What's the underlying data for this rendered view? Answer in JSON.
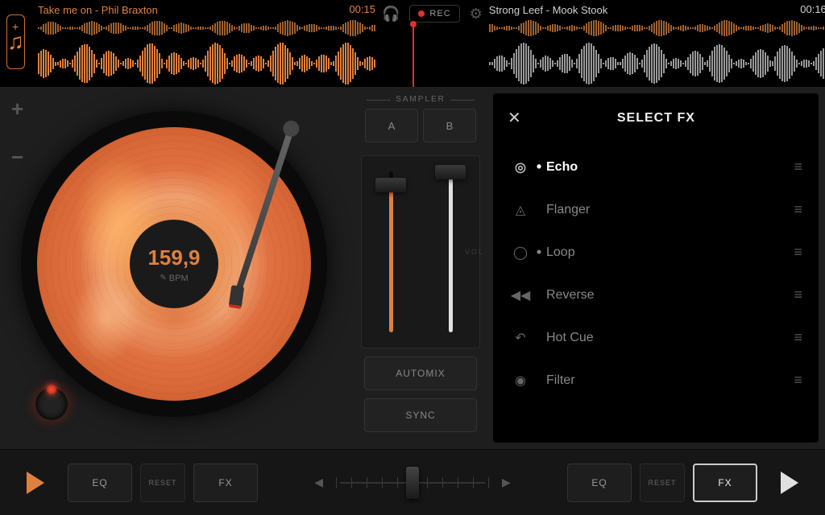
{
  "tracks": {
    "left": {
      "title": "Take me on - Phil Braxton",
      "time": "00:15"
    },
    "right": {
      "title": "Strong Leef - Mook Stook",
      "time": "00:16"
    }
  },
  "rec": {
    "label": "REC"
  },
  "deck": {
    "bpm_value": "159,9",
    "bpm_label": "BPM"
  },
  "sampler": {
    "title": "SAMPLER",
    "a": "A",
    "b": "B",
    "vol": "VOL"
  },
  "mixer": {
    "automix": "AUTOMIX",
    "sync": "SYNC"
  },
  "fx_panel": {
    "title": "SELECT FX",
    "items": [
      {
        "name": "Echo",
        "icon": "◎",
        "bullet": "•",
        "selected": true
      },
      {
        "name": "Flanger",
        "icon": "◬",
        "bullet": "",
        "selected": false
      },
      {
        "name": "Loop",
        "icon": "◯",
        "bullet": "•",
        "selected": false
      },
      {
        "name": "Reverse",
        "icon": "◀◀",
        "bullet": "",
        "selected": false
      },
      {
        "name": "Hot Cue",
        "icon": "↶",
        "bullet": "",
        "selected": false
      },
      {
        "name": "Filter",
        "icon": "◉",
        "bullet": "",
        "selected": false
      }
    ]
  },
  "bottom": {
    "eq": "EQ",
    "reset": "RESET",
    "fx": "FX"
  },
  "faders": {
    "left_pct": 90,
    "right_pct": 98
  },
  "crossfader": {
    "position_pct": 50
  },
  "colors": {
    "accent_left": "#e08040",
    "accent_right": "#e0e0e0",
    "rec": "#e03030"
  }
}
